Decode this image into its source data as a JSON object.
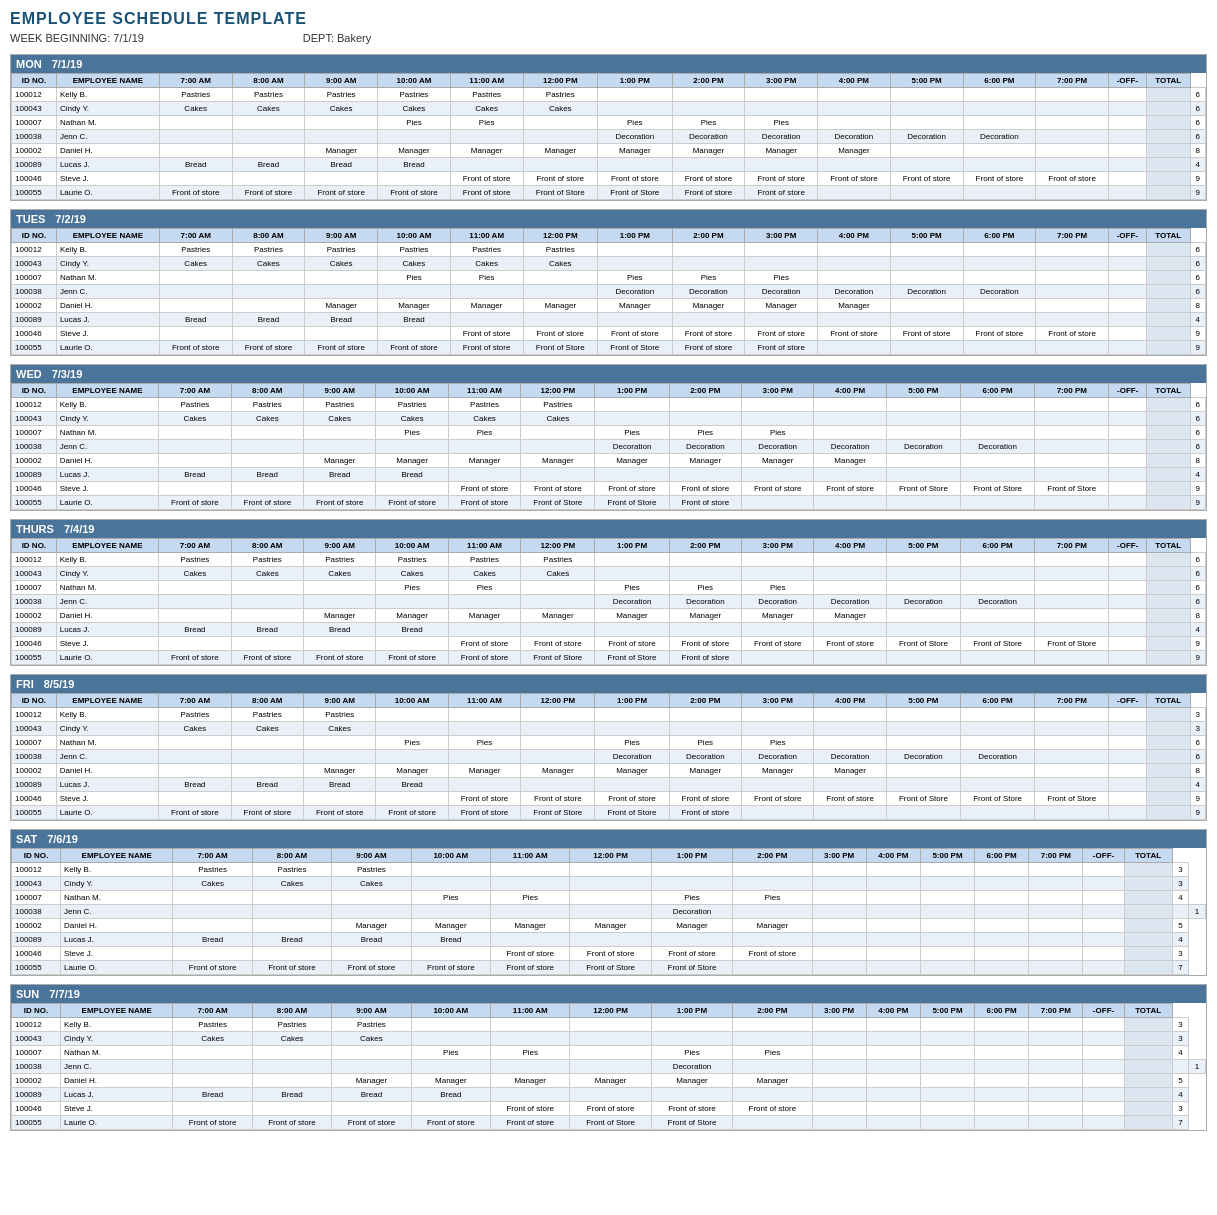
{
  "title": "EMPLOYEE SCHEDULE TEMPLATE",
  "week_beginning": "WEEK BEGINNING:  7/1/19",
  "dept": "DEPT:  Bakery",
  "columns": [
    "ID NO.",
    "EMPLOYEE NAME",
    "7:00 AM",
    "8:00 AM",
    "9:00 AM",
    "10:00 AM",
    "11:00 AM",
    "12:00 PM",
    "1:00 PM",
    "2:00 PM",
    "3:00 PM",
    "4:00 PM",
    "5:00 PM",
    "6:00 PM",
    "7:00 PM",
    "-OFF-",
    "TOTAL"
  ],
  "days": [
    {
      "day": "MON",
      "date": "7/1/19",
      "rows": [
        [
          "100012",
          "Kelly B.",
          "Pastries",
          "Pastries",
          "Pastries",
          "Pastries",
          "Pastries",
          "Pastries",
          "",
          "",
          "",
          "",
          "",
          "",
          "",
          "",
          "",
          "6"
        ],
        [
          "100043",
          "Cindy Y.",
          "Cakes",
          "Cakes",
          "Cakes",
          "Cakes",
          "Cakes",
          "Cakes",
          "",
          "",
          "",
          "",
          "",
          "",
          "",
          "",
          "",
          "6"
        ],
        [
          "100007",
          "Nathan M.",
          "",
          "",
          "",
          "Pies",
          "Pies",
          "",
          "Pies",
          "Pies",
          "Pies",
          "",
          "",
          "",
          "",
          "",
          "",
          "6"
        ],
        [
          "100038",
          "Jenn C.",
          "",
          "",
          "",
          "",
          "",
          "",
          "Decoration",
          "Decoration",
          "Decoration",
          "Decoration",
          "Decoration",
          "Decoration",
          "",
          "",
          "",
          "6"
        ],
        [
          "100002",
          "Daniel H.",
          "",
          "",
          "Manager",
          "Manager",
          "Manager",
          "Manager",
          "Manager",
          "Manager",
          "Manager",
          "Manager",
          "",
          "",
          "",
          "",
          "",
          "8"
        ],
        [
          "100089",
          "Lucas J.",
          "Bread",
          "Bread",
          "Bread",
          "Bread",
          "",
          "",
          "",
          "",
          "",
          "",
          "",
          "",
          "",
          "",
          "",
          "4"
        ],
        [
          "100046",
          "Steve J.",
          "",
          "",
          "",
          "",
          "Front of store",
          "Front of store",
          "Front of store",
          "Front of store",
          "Front of store",
          "Front of store",
          "Front of store",
          "Front of store",
          "Front of store",
          "",
          "",
          "9"
        ],
        [
          "100055",
          "Laurie O.",
          "Front of store",
          "Front of store",
          "Front of store",
          "Front of store",
          "Front of store",
          "Front of Store",
          "Front of Store",
          "Front of store",
          "Front of store",
          "",
          "",
          "",
          "",
          "",
          "",
          "9"
        ]
      ]
    },
    {
      "day": "TUES",
      "date": "7/2/19",
      "rows": [
        [
          "100012",
          "Kelly B.",
          "Pastries",
          "Pastries",
          "Pastries",
          "Pastries",
          "Pastries",
          "Pastries",
          "",
          "",
          "",
          "",
          "",
          "",
          "",
          "",
          "",
          "6"
        ],
        [
          "100043",
          "Cindy Y.",
          "Cakes",
          "Cakes",
          "Cakes",
          "Cakes",
          "Cakes",
          "Cakes",
          "",
          "",
          "",
          "",
          "",
          "",
          "",
          "",
          "",
          "6"
        ],
        [
          "100007",
          "Nathan M.",
          "",
          "",
          "",
          "Pies",
          "Pies",
          "",
          "Pies",
          "Pies",
          "Pies",
          "",
          "",
          "",
          "",
          "",
          "",
          "6"
        ],
        [
          "100038",
          "Jenn C.",
          "",
          "",
          "",
          "",
          "",
          "",
          "Decoration",
          "Decoration",
          "Decoration",
          "Decoration",
          "Decoration",
          "Decoration",
          "",
          "",
          "",
          "6"
        ],
        [
          "100002",
          "Daniel H.",
          "",
          "",
          "Manager",
          "Manager",
          "Manager",
          "Manager",
          "Manager",
          "Manager",
          "Manager",
          "Manager",
          "",
          "",
          "",
          "",
          "",
          "8"
        ],
        [
          "100089",
          "Lucas J.",
          "Bread",
          "Bread",
          "Bread",
          "Bread",
          "",
          "",
          "",
          "",
          "",
          "",
          "",
          "",
          "",
          "",
          "",
          "4"
        ],
        [
          "100046",
          "Steve J.",
          "",
          "",
          "",
          "",
          "Front of store",
          "Front of store",
          "Front of store",
          "Front of store",
          "Front of store",
          "Front of store",
          "Front of store",
          "Front of store",
          "Front of store",
          "",
          "",
          "9"
        ],
        [
          "100055",
          "Laurie O.",
          "Front of store",
          "Front of store",
          "Front of store",
          "Front of store",
          "Front of store",
          "Front of Store",
          "Front of Store",
          "Front of store",
          "Front of store",
          "",
          "",
          "",
          "",
          "",
          "",
          "9"
        ]
      ]
    },
    {
      "day": "WED",
      "date": "7/3/19",
      "rows": [
        [
          "100012",
          "Kelly B.",
          "Pastries",
          "Pastries",
          "Pastries",
          "Pastries",
          "Pastries",
          "Pastries",
          "",
          "",
          "",
          "",
          "",
          "",
          "",
          "",
          "",
          "6"
        ],
        [
          "100043",
          "Cindy Y.",
          "Cakes",
          "Cakes",
          "Cakes",
          "Cakes",
          "Cakes",
          "Cakes",
          "",
          "",
          "",
          "",
          "",
          "",
          "",
          "",
          "",
          "6"
        ],
        [
          "100007",
          "Nathan M.",
          "",
          "",
          "",
          "Pies",
          "Pies",
          "",
          "Pies",
          "Pies",
          "Pies",
          "",
          "",
          "",
          "",
          "",
          "",
          "6"
        ],
        [
          "100038",
          "Jenn C.",
          "",
          "",
          "",
          "",
          "",
          "",
          "Decoration",
          "Decoration",
          "Decoration",
          "Decoration",
          "Decoration",
          "Decoration",
          "",
          "",
          "",
          "6"
        ],
        [
          "100002",
          "Daniel H.",
          "",
          "",
          "Manager",
          "Manager",
          "Manager",
          "Manager",
          "Manager",
          "Manager",
          "Manager",
          "Manager",
          "",
          "",
          "",
          "",
          "",
          "8"
        ],
        [
          "100089",
          "Lucas J.",
          "Bread",
          "Bread",
          "Bread",
          "Bread",
          "",
          "",
          "",
          "",
          "",
          "",
          "",
          "",
          "",
          "",
          "",
          "4"
        ],
        [
          "100046",
          "Steve J.",
          "",
          "",
          "",
          "",
          "Front of store",
          "Front of store",
          "Front of store",
          "Front of store",
          "Front of store",
          "Front of store",
          "Front of Store",
          "Front of Store",
          "Front of Store",
          "",
          "",
          "9"
        ],
        [
          "100055",
          "Laurie O.",
          "Front of store",
          "Front of store",
          "Front of store",
          "Front of store",
          "Front of store",
          "Front of Store",
          "Front of Store",
          "Front of store",
          "",
          "",
          "",
          "",
          "",
          "",
          "",
          "9"
        ]
      ]
    },
    {
      "day": "THURS",
      "date": "7/4/19",
      "rows": [
        [
          "100012",
          "Kelly B.",
          "Pastries",
          "Pastries",
          "Pastries",
          "Pastries",
          "Pastries",
          "Pastries",
          "",
          "",
          "",
          "",
          "",
          "",
          "",
          "",
          "",
          "6"
        ],
        [
          "100043",
          "Cindy Y.",
          "Cakes",
          "Cakes",
          "Cakes",
          "Cakes",
          "Cakes",
          "Cakes",
          "",
          "",
          "",
          "",
          "",
          "",
          "",
          "",
          "",
          "6"
        ],
        [
          "100007",
          "Nathan M.",
          "",
          "",
          "",
          "Pies",
          "Pies",
          "",
          "Pies",
          "Pies",
          "Pies",
          "",
          "",
          "",
          "",
          "",
          "",
          "6"
        ],
        [
          "100038",
          "Jenn C.",
          "",
          "",
          "",
          "",
          "",
          "",
          "Decoration",
          "Decoration",
          "Decoration",
          "Decoration",
          "Decoration",
          "Decoration",
          "",
          "",
          "",
          "6"
        ],
        [
          "100002",
          "Daniel H.",
          "",
          "",
          "Manager",
          "Manager",
          "Manager",
          "Manager",
          "Manager",
          "Manager",
          "Manager",
          "Manager",
          "",
          "",
          "",
          "",
          "",
          "8"
        ],
        [
          "100089",
          "Lucas J.",
          "Bread",
          "Bread",
          "Bread",
          "Bread",
          "",
          "",
          "",
          "",
          "",
          "",
          "",
          "",
          "",
          "",
          "",
          "4"
        ],
        [
          "100046",
          "Steve J.",
          "",
          "",
          "",
          "",
          "Front of store",
          "Front of store",
          "Front of store",
          "Front of store",
          "Front of store",
          "Front of store",
          "Front of Store",
          "Front of Store",
          "Front of Store",
          "",
          "",
          "9"
        ],
        [
          "100055",
          "Laurie O.",
          "Front of store",
          "Front of store",
          "Front of store",
          "Front of store",
          "Front of store",
          "Front of Store",
          "Front of Store",
          "Front of store",
          "",
          "",
          "",
          "",
          "",
          "",
          "",
          "9"
        ]
      ]
    },
    {
      "day": "FRI",
      "date": "8/5/19",
      "rows": [
        [
          "100012",
          "Kelly B.",
          "Pastries",
          "Pastries",
          "Pastries",
          "",
          "",
          "",
          "",
          "",
          "",
          "",
          "",
          "",
          "",
          "",
          "",
          "3"
        ],
        [
          "100043",
          "Cindy Y.",
          "Cakes",
          "Cakes",
          "Cakes",
          "",
          "",
          "",
          "",
          "",
          "",
          "",
          "",
          "",
          "",
          "",
          "",
          "3"
        ],
        [
          "100007",
          "Nathan M.",
          "",
          "",
          "",
          "Pies",
          "Pies",
          "",
          "Pies",
          "Pies",
          "Pies",
          "",
          "",
          "",
          "",
          "",
          "",
          "6"
        ],
        [
          "100038",
          "Jenn C.",
          "",
          "",
          "",
          "",
          "",
          "",
          "Decoration",
          "Decoration",
          "Decoration",
          "Decoration",
          "Decoration",
          "Decoration",
          "",
          "",
          "",
          "6"
        ],
        [
          "100002",
          "Daniel H.",
          "",
          "",
          "Manager",
          "Manager",
          "Manager",
          "Manager",
          "Manager",
          "Manager",
          "Manager",
          "Manager",
          "",
          "",
          "",
          "",
          "",
          "8"
        ],
        [
          "100089",
          "Lucas J.",
          "Bread",
          "Bread",
          "Bread",
          "Bread",
          "",
          "",
          "",
          "",
          "",
          "",
          "",
          "",
          "",
          "",
          "",
          "4"
        ],
        [
          "100046",
          "Steve J.",
          "",
          "",
          "",
          "",
          "Front of store",
          "Front of store",
          "Front of store",
          "Front of store",
          "Front of store",
          "Front of store",
          "Front of Store",
          "Front of Store",
          "Front of Store",
          "",
          "",
          "9"
        ],
        [
          "100055",
          "Laurie O.",
          "Front of store",
          "Front of store",
          "Front of store",
          "Front of store",
          "Front of store",
          "Front of Store",
          "Front of Store",
          "Front of store",
          "",
          "",
          "",
          "",
          "",
          "",
          "",
          "9"
        ]
      ]
    },
    {
      "day": "SAT",
      "date": "7/6/19",
      "rows": [
        [
          "100012",
          "Kelly B.",
          "Pastries",
          "Pastries",
          "Pastries",
          "",
          "",
          "",
          "",
          "",
          "",
          "",
          "",
          "",
          "",
          "",
          "",
          "3"
        ],
        [
          "100043",
          "Cindy Y.",
          "Cakes",
          "Cakes",
          "Cakes",
          "",
          "",
          "",
          "",
          "",
          "",
          "",
          "",
          "",
          "",
          "",
          "",
          "3"
        ],
        [
          "100007",
          "Nathan M.",
          "",
          "",
          "",
          "Pies",
          "Pies",
          "",
          "Pies",
          "Pies",
          "",
          "",
          "",
          "",
          "",
          "",
          "",
          "4"
        ],
        [
          "100038",
          "Jenn C.",
          "",
          "",
          "",
          "",
          "",
          "",
          "Decoration",
          "",
          "",
          "",
          "",
          "",
          "",
          "",
          "",
          "",
          "1"
        ],
        [
          "100002",
          "Daniel H.",
          "",
          "",
          "Manager",
          "Manager",
          "Manager",
          "Manager",
          "Manager",
          "Manager",
          "",
          "",
          "",
          "",
          "",
          "",
          "",
          "5"
        ],
        [
          "100089",
          "Lucas J.",
          "Bread",
          "Bread",
          "Bread",
          "Bread",
          "",
          "",
          "",
          "",
          "",
          "",
          "",
          "",
          "",
          "",
          "",
          "4"
        ],
        [
          "100046",
          "Steve J.",
          "",
          "",
          "",
          "",
          "Front of store",
          "Front of store",
          "Front of store",
          "Front of store",
          "",
          "",
          "",
          "",
          "",
          "",
          "",
          "3"
        ],
        [
          "100055",
          "Laurie O.",
          "Front of store",
          "Front of store",
          "Front of store",
          "Front of store",
          "Front of store",
          "Front of Store",
          "Front of Store",
          "",
          "",
          "",
          "",
          "",
          "",
          "",
          "",
          "7"
        ]
      ]
    },
    {
      "day": "SUN",
      "date": "7/7/19",
      "rows": [
        [
          "100012",
          "Kelly B.",
          "Pastries",
          "Pastries",
          "Pastries",
          "",
          "",
          "",
          "",
          "",
          "",
          "",
          "",
          "",
          "",
          "",
          "",
          "3"
        ],
        [
          "100043",
          "Cindy Y.",
          "Cakes",
          "Cakes",
          "Cakes",
          "",
          "",
          "",
          "",
          "",
          "",
          "",
          "",
          "",
          "",
          "",
          "",
          "3"
        ],
        [
          "100007",
          "Nathan M.",
          "",
          "",
          "",
          "Pies",
          "Pies",
          "",
          "Pies",
          "Pies",
          "",
          "",
          "",
          "",
          "",
          "",
          "",
          "4"
        ],
        [
          "100038",
          "Jenn C.",
          "",
          "",
          "",
          "",
          "",
          "",
          "Decoration",
          "",
          "",
          "",
          "",
          "",
          "",
          "",
          "",
          "",
          "1"
        ],
        [
          "100002",
          "Daniel H.",
          "",
          "",
          "Manager",
          "Manager",
          "Manager",
          "Manager",
          "Manager",
          "Manager",
          "",
          "",
          "",
          "",
          "",
          "",
          "",
          "5"
        ],
        [
          "100089",
          "Lucas J.",
          "Bread",
          "Bread",
          "Bread",
          "Bread",
          "",
          "",
          "",
          "",
          "",
          "",
          "",
          "",
          "",
          "",
          "",
          "4"
        ],
        [
          "100046",
          "Steve J.",
          "",
          "",
          "",
          "",
          "Front of store",
          "Front of store",
          "Front of store",
          "Front of store",
          "",
          "",
          "",
          "",
          "",
          "",
          "",
          "3"
        ],
        [
          "100055",
          "Laurie O.",
          "Front of store",
          "Front of store",
          "Front of store",
          "Front of store",
          "Front of store",
          "Front of Store",
          "Front of Store",
          "",
          "",
          "",
          "",
          "",
          "",
          "",
          "",
          "7"
        ]
      ]
    }
  ]
}
